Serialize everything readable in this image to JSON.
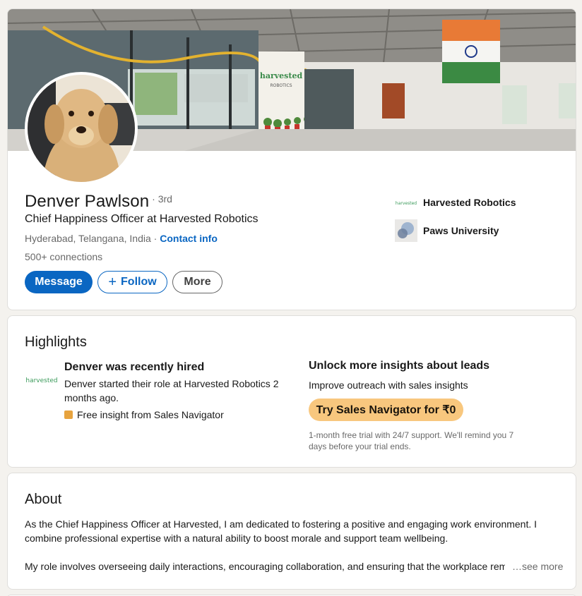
{
  "profile": {
    "name": "Denver Pawlson",
    "degree": "· 3rd",
    "headline": "Chief Happiness Officer at Harvested Robotics",
    "location": "Hyderabad, Telangana, India",
    "location_separator": " · ",
    "contact_info": "Contact info",
    "connections": "500+ connections",
    "banner_sign": "harvested",
    "banner_sign_sub": "ROBOTICS"
  },
  "actions": {
    "message": "Message",
    "follow": "Follow",
    "follow_icon": "+",
    "more": "More"
  },
  "organizations": [
    {
      "name": "Harvested Robotics",
      "logo_text": "harvested",
      "logo_icon": "harvested-robotics-logo"
    },
    {
      "name": "Paws University",
      "logo_icon": "paws-university-logo"
    }
  ],
  "highlights": {
    "title": "Highlights",
    "hired": {
      "logo_text": "harvested",
      "heading": "Denver was recently hired",
      "description": "Denver started their role at Harvested Robotics 2 months ago.",
      "insight": "Free insight from Sales Navigator",
      "insight_icon": "sales-navigator-icon"
    },
    "unlock": {
      "heading": "Unlock more insights about leads",
      "description": "Improve outreach with sales insights",
      "button": "Try Sales Navigator for ₹0",
      "note": "1-month free trial with 24/7 support. We'll remind you 7 days before your trial ends."
    }
  },
  "about": {
    "title": "About",
    "paragraph_1": "As the Chief Happiness Officer at Harvested, I am dedicated to fostering a positive and engaging work environment. I combine professional expertise with a natural ability to boost morale and support team wellbeing.",
    "paragraph_2": "My role involves overseeing daily interactions, encouraging collaboration, and ensuring that the workplace remains",
    "see_more": "…see more"
  },
  "colors": {
    "primary": "#0a66c2",
    "sales_navigator": "#f8c77e",
    "harvested_green": "#3a9a5a",
    "page_bg": "#f4f2ee"
  }
}
